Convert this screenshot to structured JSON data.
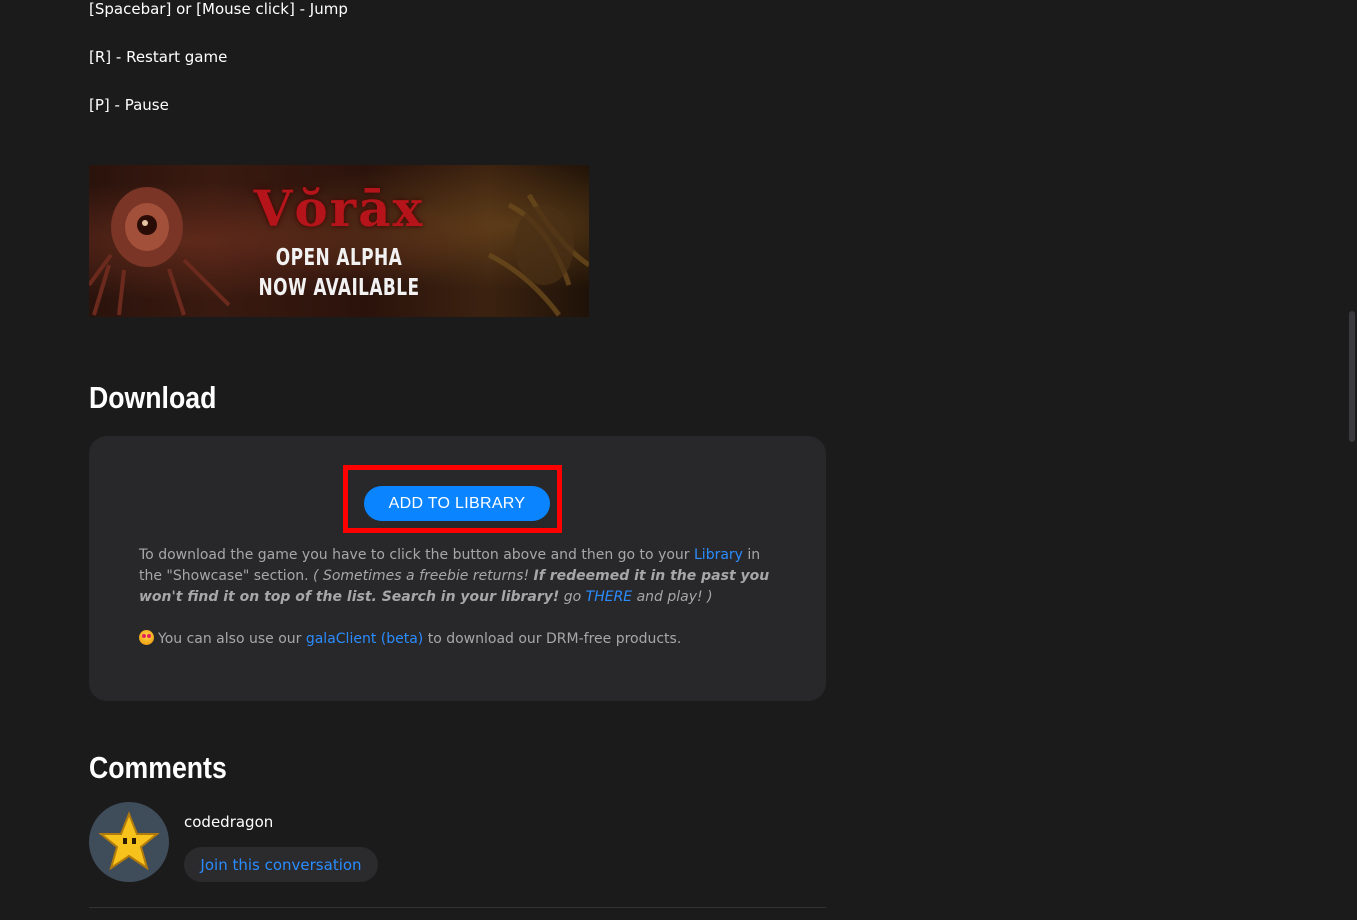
{
  "controls": {
    "jump": "[Spacebar] or [Mouse click] - Jump",
    "restart": "[R] - Restart game",
    "pause": "[P] - Pause"
  },
  "banner": {
    "title": "Vŏrāx",
    "line1": "OPEN ALPHA",
    "line2": "NOW AVAILABLE"
  },
  "download": {
    "heading": "Download",
    "add_button": "ADD TO LIBRARY",
    "text_part1": "To download the game you have to click the button above and then go to your ",
    "library_link": "Library",
    "text_part2": " in the \"Showcase\" section. ",
    "italic_part1": "( Sometimes a freebie returns! ",
    "bold_italic_part": "If redeemed it in the past you won't find it on top of the list. Search in your library!",
    "italic_part2": " go ",
    "there_link": "THERE",
    "italic_part3": " and play! )",
    "client_text1": "You can also use our ",
    "client_link": "galaClient (beta)",
    "client_text2": " to download our DRM-free products."
  },
  "comments": {
    "heading": "Comments",
    "username": "codedragon",
    "join_button": "Join this conversation"
  },
  "colors": {
    "background": "#1b1b1c",
    "card": "#28282a",
    "accent": "#0a84ff",
    "link": "#2b8cff",
    "highlight": "#ff0000"
  }
}
